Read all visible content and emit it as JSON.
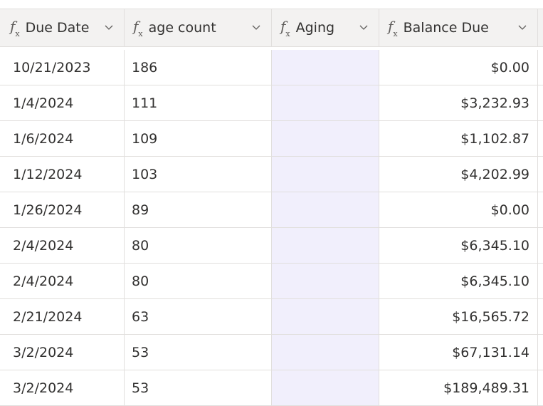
{
  "columns": [
    {
      "label": "Due Date",
      "icon": "fx-icon"
    },
    {
      "label": "age count",
      "icon": "fx-icon"
    },
    {
      "label": "Aging",
      "icon": "fx-icon"
    },
    {
      "label": "Balance Due",
      "icon": "fx-icon"
    }
  ],
  "rows": [
    {
      "due_date": "10/21/2023",
      "age_count": "186",
      "aging": "",
      "balance_due": "$0.00"
    },
    {
      "due_date": "1/4/2024",
      "age_count": "111",
      "aging": "",
      "balance_due": "$3,232.93"
    },
    {
      "due_date": "1/6/2024",
      "age_count": "109",
      "aging": "",
      "balance_due": "$1,102.87"
    },
    {
      "due_date": "1/12/2024",
      "age_count": "103",
      "aging": "",
      "balance_due": "$4,202.99"
    },
    {
      "due_date": "1/26/2024",
      "age_count": "89",
      "aging": "",
      "balance_due": "$0.00"
    },
    {
      "due_date": "2/4/2024",
      "age_count": "80",
      "aging": "",
      "balance_due": "$6,345.10"
    },
    {
      "due_date": "2/4/2024",
      "age_count": "80",
      "aging": "",
      "balance_due": "$6,345.10"
    },
    {
      "due_date": "2/21/2024",
      "age_count": "63",
      "aging": "",
      "balance_due": "$16,565.72"
    },
    {
      "due_date": "3/2/2024",
      "age_count": "53",
      "aging": "",
      "balance_due": "$67,131.14"
    },
    {
      "due_date": "3/2/2024",
      "age_count": "53",
      "aging": "",
      "balance_due": "$189,489.31"
    }
  ],
  "colors": {
    "header_bg": "#f3f2f1",
    "border": "#e1dfdd",
    "aging_column_bg": "#f1effc",
    "text": "#323130"
  }
}
